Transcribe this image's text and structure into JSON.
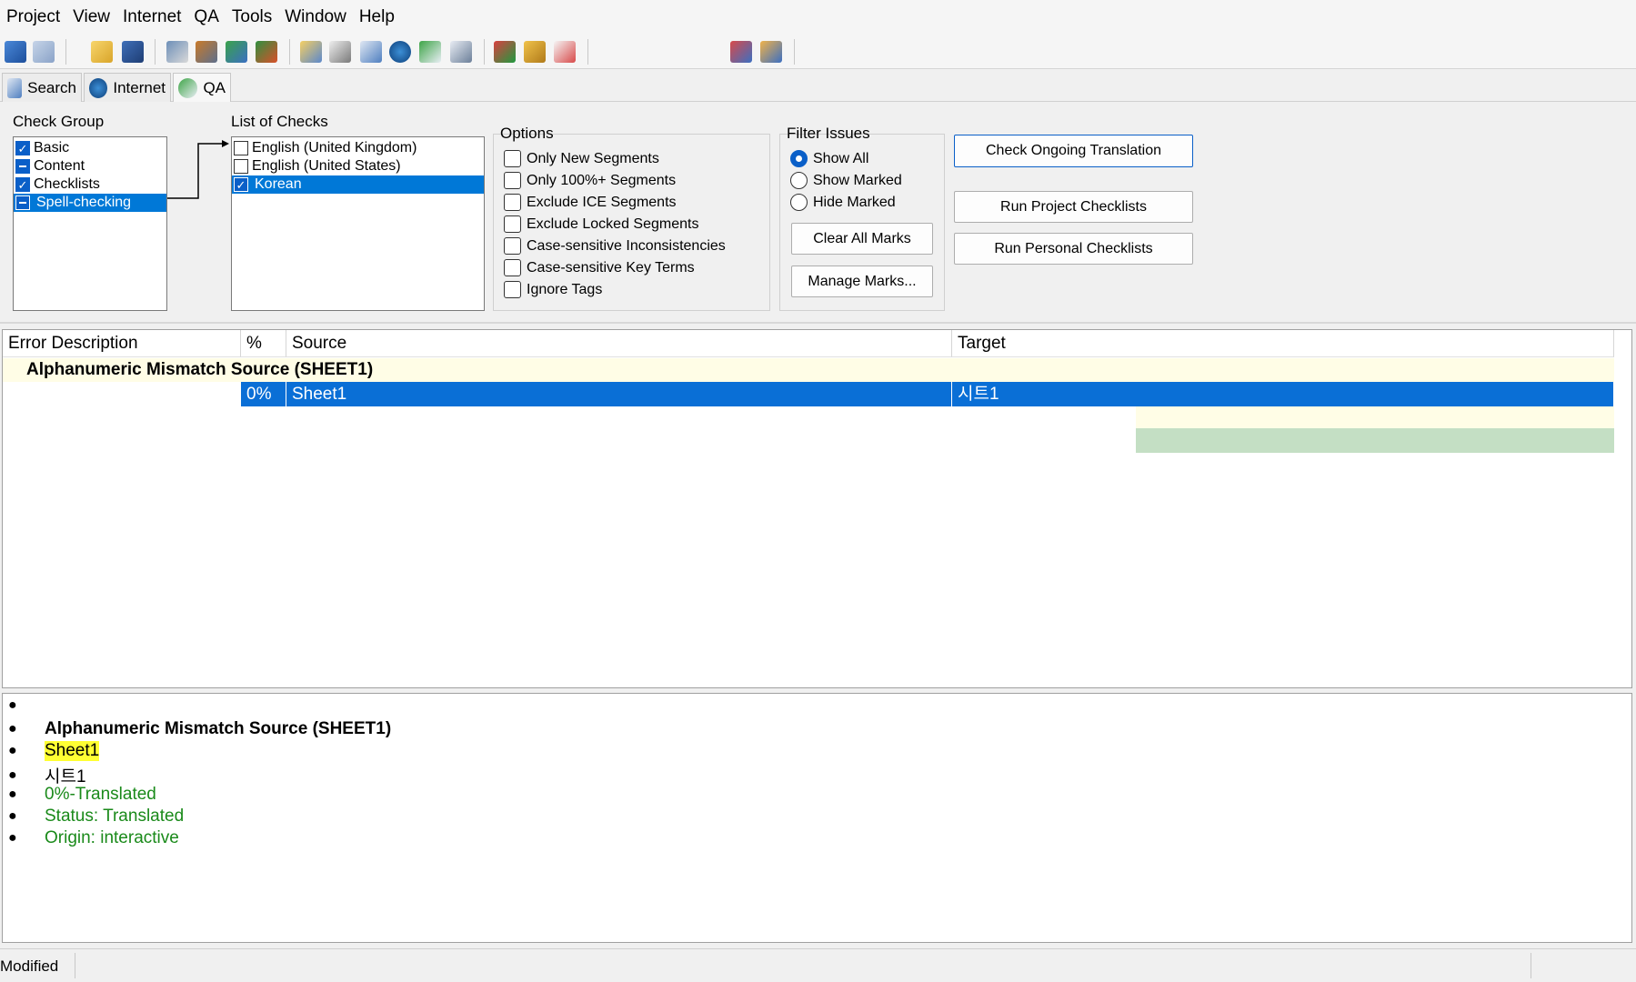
{
  "menu": [
    "Project",
    "View",
    "Internet",
    "QA",
    "Tools",
    "Window",
    "Help"
  ],
  "toolbar_icons": [
    "back-icon",
    "forward-icon",
    "open-folder-icon",
    "save-icon",
    "project-icon",
    "settings-icon",
    "refresh-icon",
    "tools-icon",
    "folder-icon",
    "list-icon",
    "search-doc-icon",
    "search-icon",
    "qa-icon",
    "checklist-icon",
    "spellcheck-icon",
    "gear-icon",
    "shield-icon",
    "tree-icon",
    "users-icon"
  ],
  "tabs": [
    {
      "label": "Search",
      "icon": "search-tab-icon"
    },
    {
      "label": "Internet",
      "icon": "globe-icon"
    },
    {
      "label": "QA",
      "icon": "qa-check-icon"
    }
  ],
  "check_group": {
    "label": "Check Group",
    "items": [
      {
        "label": "Basic",
        "state": "checked"
      },
      {
        "label": "Content",
        "state": "indeterminate"
      },
      {
        "label": "Checklists",
        "state": "checked"
      },
      {
        "label": "Spell-checking",
        "state": "indeterminate",
        "selected": true
      }
    ]
  },
  "list_of_checks": {
    "label": "List of Checks",
    "items": [
      {
        "label": "English (United Kingdom)",
        "checked": false
      },
      {
        "label": "English (United States)",
        "checked": false
      },
      {
        "label": "Korean",
        "checked": true,
        "selected": true
      }
    ]
  },
  "options": {
    "label": "Options",
    "items": [
      "Only New Segments",
      "Only 100%+ Segments",
      "Exclude ICE Segments",
      "Exclude Locked Segments",
      "Case-sensitive Inconsistencies",
      "Case-sensitive Key Terms",
      "Ignore Tags"
    ]
  },
  "filter": {
    "label": "Filter Issues",
    "radios": [
      {
        "label": "Show All",
        "selected": true
      },
      {
        "label": "Show Marked",
        "selected": false
      },
      {
        "label": "Hide Marked",
        "selected": false
      }
    ],
    "clear_label": "Clear All Marks",
    "manage_label": "Manage Marks..."
  },
  "buttons": {
    "check_ongoing": "Check Ongoing Translation",
    "run_project": "Run Project Checklists",
    "run_personal": "Run Personal Checklists"
  },
  "grid": {
    "columns": [
      "Error Description",
      "%",
      "Source",
      "Target"
    ],
    "group": "Alphanumeric Mismatch Source (SHEET1)",
    "row": {
      "percent": "0%",
      "source": "Sheet1",
      "target": "시트1"
    }
  },
  "detail": {
    "title": "Alphanumeric Mismatch Source (SHEET1)",
    "source": "Sheet1",
    "target": "시트1",
    "match": "0%-Translated",
    "status": "Status: Translated",
    "origin": "Origin: interactive"
  },
  "statusbar": {
    "text": "Modified"
  },
  "colors": {
    "accent": "#0a6fd6",
    "highlight": "#ffff33",
    "info_green": "#1a8a1a",
    "group_bg": "#fffde6"
  }
}
